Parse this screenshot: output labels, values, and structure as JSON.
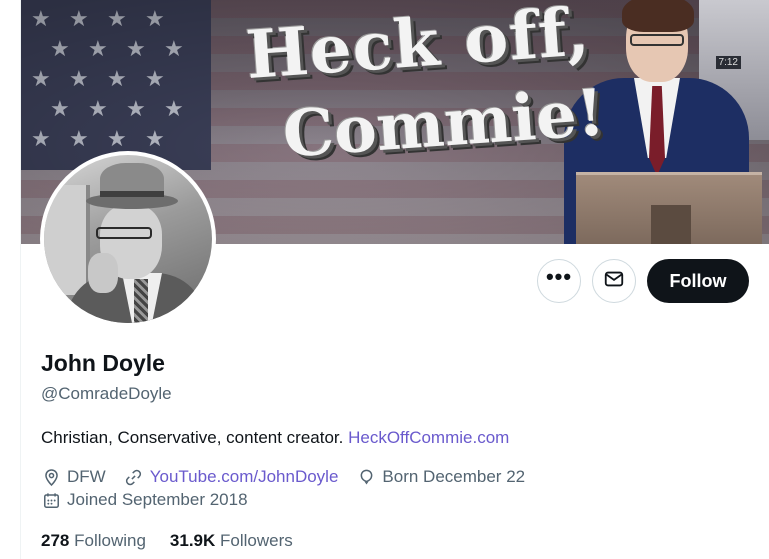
{
  "banner": {
    "headline_line1": "Heck off,",
    "headline_line2": "Commie!",
    "tv_time": "7:12"
  },
  "profile": {
    "name": "John Doyle",
    "handle": "@ComradeDoyle",
    "bio_text": "Christian, Conservative, content creator. ",
    "bio_link": "HeckOffCommie.com",
    "location": "DFW",
    "website": "YouTube.com/JohnDoyle",
    "birthday": "Born December 22",
    "joined": "Joined September 2018"
  },
  "actions": {
    "more_label": "•••",
    "follow_label": "Follow"
  },
  "counts": {
    "following_count": "278",
    "following_label": "Following",
    "followers_count": "31.9K",
    "followers_label": "Followers"
  },
  "icons": {
    "more": "more-icon",
    "message": "envelope-icon",
    "location": "location-pin-icon",
    "website": "link-icon",
    "birthday": "balloon-icon",
    "joined": "calendar-icon"
  },
  "colors": {
    "link": "#6a5acd",
    "secondary_text": "#536471",
    "primary_text": "#0f1419",
    "follow_bg": "#0f1419"
  }
}
